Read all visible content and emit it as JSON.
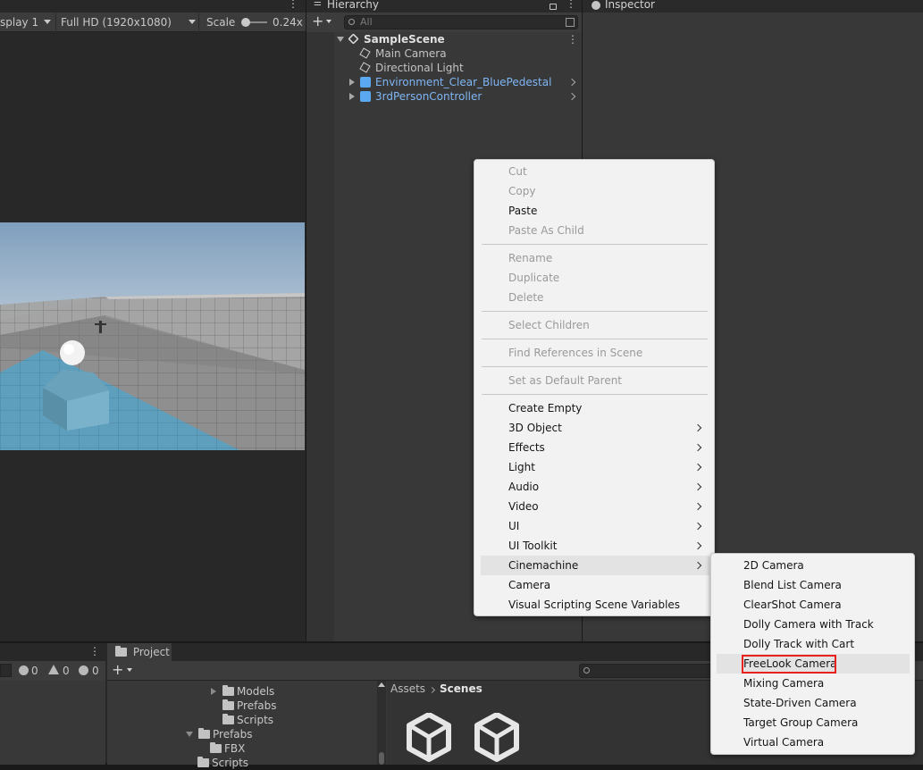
{
  "game_view": {
    "display": "splay 1",
    "resolution": "Full HD (1920x1080)",
    "scale_label": "Scale",
    "scale_value": "0.24x"
  },
  "hierarchy": {
    "tab_title": "Hierarchy",
    "add_label": "+",
    "search_placeholder": "All",
    "scene_name": "SampleScene",
    "items": [
      {
        "name": "Main Camera"
      },
      {
        "name": "Directional Light"
      },
      {
        "name": "Environment_Clear_BluePedestal"
      },
      {
        "name": "3rdPersonController"
      }
    ]
  },
  "inspector": {
    "tab_title": "Inspector"
  },
  "context_menu": {
    "items": [
      {
        "label": "Cut",
        "enabled": false
      },
      {
        "label": "Copy",
        "enabled": false
      },
      {
        "label": "Paste",
        "enabled": true
      },
      {
        "label": "Paste As Child",
        "enabled": false
      },
      {
        "label": "Rename",
        "enabled": false
      },
      {
        "label": "Duplicate",
        "enabled": false
      },
      {
        "label": "Delete",
        "enabled": false
      },
      {
        "label": "Select Children",
        "enabled": false
      },
      {
        "label": "Find References in Scene",
        "enabled": false
      },
      {
        "label": "Set as Default Parent",
        "enabled": false
      },
      {
        "label": "Create Empty",
        "enabled": true
      },
      {
        "label": "3D Object",
        "enabled": true,
        "submenu": true
      },
      {
        "label": "Effects",
        "enabled": true,
        "submenu": true
      },
      {
        "label": "Light",
        "enabled": true,
        "submenu": true
      },
      {
        "label": "Audio",
        "enabled": true,
        "submenu": true
      },
      {
        "label": "Video",
        "enabled": true,
        "submenu": true
      },
      {
        "label": "UI",
        "enabled": true,
        "submenu": true
      },
      {
        "label": "UI Toolkit",
        "enabled": true,
        "submenu": true
      },
      {
        "label": "Cinemachine",
        "enabled": true,
        "submenu": true,
        "highlighted": true
      },
      {
        "label": "Camera",
        "enabled": true
      },
      {
        "label": "Visual Scripting Scene Variables",
        "enabled": true
      }
    ]
  },
  "cinemachine_submenu": {
    "items": [
      {
        "label": "2D Camera"
      },
      {
        "label": "Blend List Camera"
      },
      {
        "label": "ClearShot Camera"
      },
      {
        "label": "Dolly Camera with Track"
      },
      {
        "label": "Dolly Track with Cart"
      },
      {
        "label": "FreeLook Camera",
        "highlighted": true
      },
      {
        "label": "Mixing Camera"
      },
      {
        "label": "State-Driven Camera"
      },
      {
        "label": "Target Group Camera"
      },
      {
        "label": "Virtual Camera"
      }
    ],
    "highlight_color": "#e8211c"
  },
  "console": {
    "error_count": "0",
    "warning_count": "0",
    "info_count": "0"
  },
  "project": {
    "tab_title": "Project",
    "add_label": "+",
    "breadcrumb": [
      "Assets",
      "Scenes"
    ],
    "tree": [
      {
        "label": "Models"
      },
      {
        "label": "Prefabs"
      },
      {
        "label": "Scripts"
      },
      {
        "label": "Prefabs"
      },
      {
        "label": "FBX"
      },
      {
        "label": "Scripts"
      }
    ]
  }
}
